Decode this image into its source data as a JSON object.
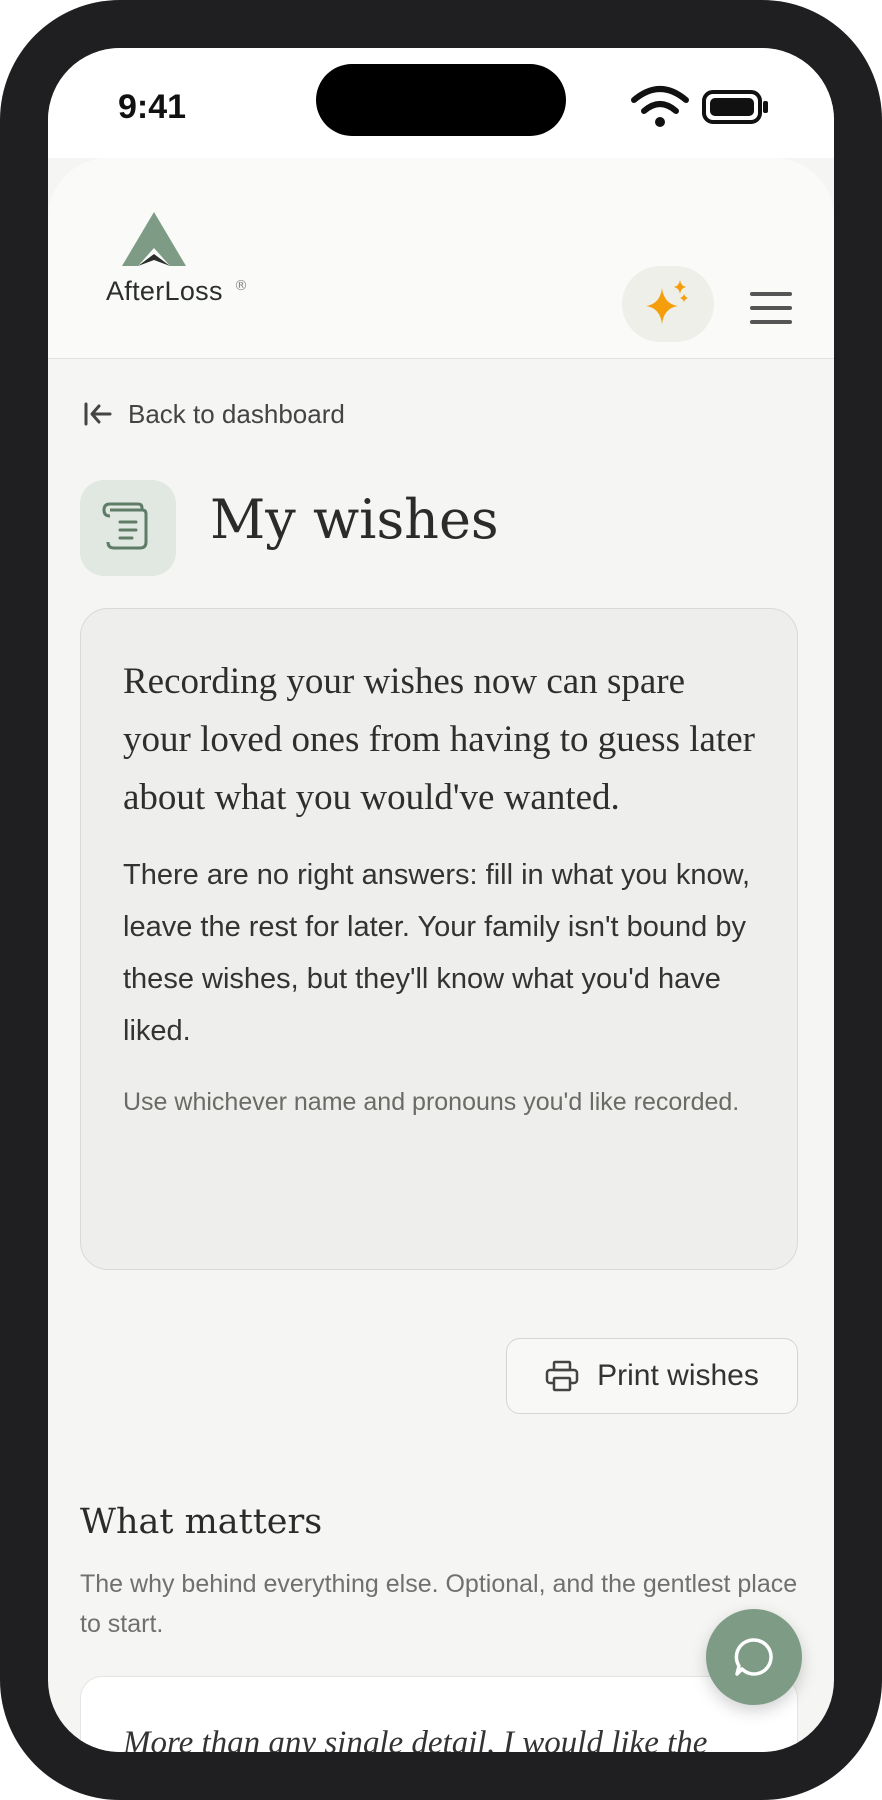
{
  "status": {
    "time": "9:41"
  },
  "brand": {
    "name": "AfterLoss",
    "reg": "®"
  },
  "nav": {
    "back_label": "Back to dashboard"
  },
  "page": {
    "title": "My wishes"
  },
  "intro": {
    "lead": "Recording your wishes now can spare your loved ones from having to guess later about what you would've wanted.",
    "body": "There are no right answers: fill in what you know, leave the rest for later. Your family isn't bound by these wishes, but they'll know what you'd have liked.",
    "note": "Use whichever name and pronouns you'd like recorded."
  },
  "actions": {
    "print_label": "Print wishes"
  },
  "section": {
    "title": "What matters",
    "description": "The why behind everything else. Optional, and the gentlest place to start.",
    "quote_preview": "More than any single detail, I would like the"
  },
  "icons": {
    "sparkle": "sparkle-icon",
    "menu": "hamburger-menu-icon",
    "back": "arrow-left-icon",
    "scroll": "scroll-icon",
    "print": "printer-icon",
    "chat": "chat-bubble-icon"
  },
  "colors": {
    "accent": "#f59e0b",
    "brand_green": "#7e9c85",
    "card_bg": "#eeefec"
  }
}
